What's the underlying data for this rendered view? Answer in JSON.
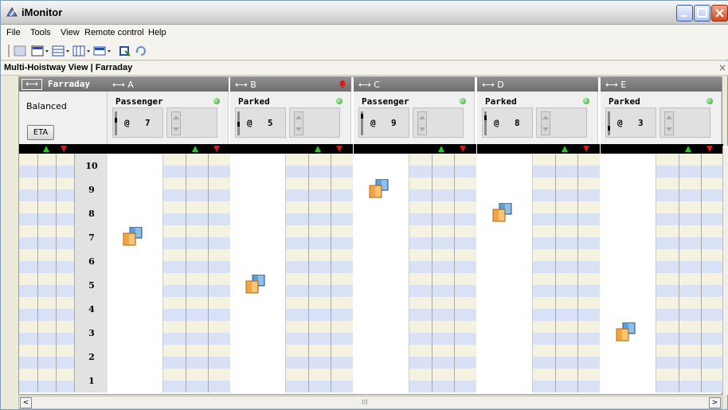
{
  "window": {
    "title": "iMonitor",
    "icon": "imonitor-app-icon"
  },
  "menu": [
    "File",
    "Tools",
    "View",
    "Remote control",
    "Help"
  ],
  "toolbar": {
    "icons": [
      "view-icon",
      "layout-grid-icon",
      "horizontal-split-icon",
      "vertical-split-icon",
      "panel-icon",
      "export-icon",
      "refresh-icon"
    ]
  },
  "panel": {
    "title": "Multi-Hoistway View | Farraday",
    "close": "×"
  },
  "group": {
    "arrow": "⟷",
    "name": "Farraday",
    "mode": "Balanced",
    "eta_label": "ETA"
  },
  "floors": [
    "10",
    "9",
    "8",
    "7",
    "6",
    "5",
    "4",
    "3",
    "2",
    "1"
  ],
  "cars": [
    {
      "id": "A",
      "label": "⟷ A",
      "mode": "Passenger",
      "at": "@",
      "floor": "7",
      "alarm": false,
      "status_color": "#2ca02c"
    },
    {
      "id": "B",
      "label": "⟷ B",
      "mode": "Parked",
      "at": "@",
      "floor": "5",
      "alarm": true,
      "status_color": "#2ca02c"
    },
    {
      "id": "C",
      "label": "⟷ C",
      "mode": "Passenger",
      "at": "@",
      "floor": "9",
      "alarm": false,
      "status_color": "#2ca02c"
    },
    {
      "id": "D",
      "label": "⟷ D",
      "mode": "Parked",
      "at": "@",
      "floor": "8",
      "alarm": false,
      "status_color": "#2ca02c"
    },
    {
      "id": "E",
      "label": "⟷ E",
      "mode": "Parked",
      "at": "@",
      "floor": "3",
      "alarm": false,
      "status_color": "#2ca02c"
    }
  ],
  "colors": {
    "up": "#2dc22d",
    "down": "#e11111",
    "stripe_a": "#f6f2e0",
    "stripe_b": "#d9e2f4"
  },
  "hscroll": {
    "left": "<",
    "right": ">",
    "grip": "III"
  }
}
